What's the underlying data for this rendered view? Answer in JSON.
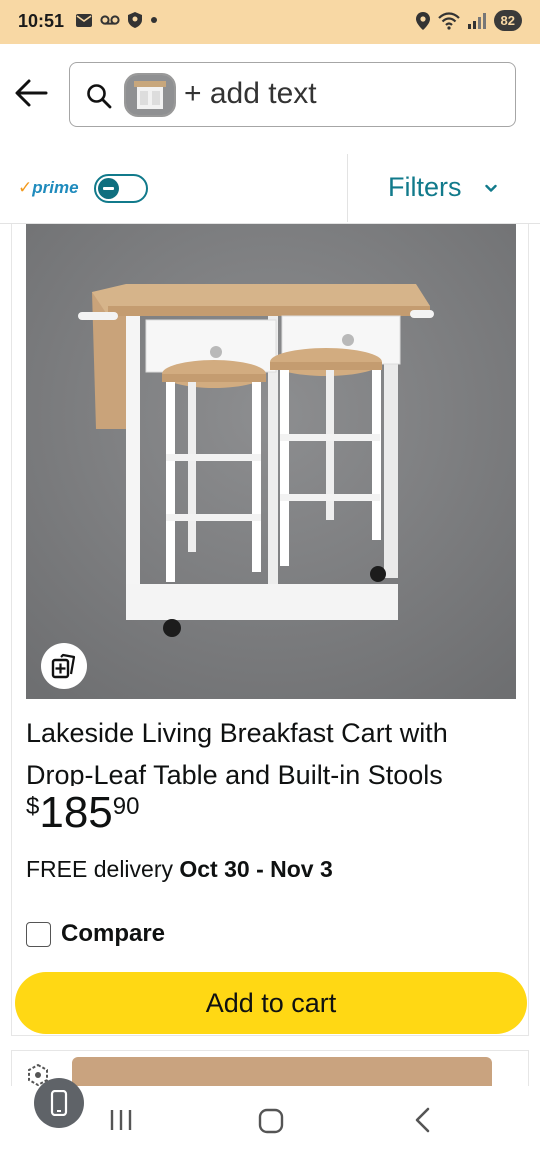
{
  "status_bar": {
    "time": "10:51",
    "battery": "82",
    "left_icons": [
      "mail-icon",
      "voicemail-icon",
      "shield-icon",
      "dot-icon"
    ],
    "right_icons": [
      "location-icon",
      "wifi-icon",
      "signal-icon"
    ]
  },
  "header": {
    "back_icon": "arrow-left-icon",
    "search_icon": "search-icon",
    "search_placeholder": "+ add text"
  },
  "filter_bar": {
    "prime_check": "✓",
    "prime_label": "prime",
    "prime_toggle_on": false,
    "filters_label": "Filters"
  },
  "product": {
    "title": "Lakeside Living Breakfast Cart with Drop-Leaf Table and Built-in Stools",
    "price_currency": "$",
    "price_whole": "185",
    "price_fraction": "90",
    "delivery_prefix": "FREE delivery ",
    "delivery_dates": "Oct 30 - Nov 3",
    "compare_label": "Compare",
    "compare_checked": false,
    "add_to_cart_label": "Add to cart"
  },
  "colors": {
    "status_bar": "#f8d8a4",
    "teal_accent": "#117a8b",
    "prime_blue": "#1f8bbd",
    "cart_button": "#ffd814"
  },
  "nav_bar": {
    "icons": [
      "recents-icon",
      "home-icon",
      "back-chevron-icon"
    ],
    "floating_button_icon": "phone-icon"
  }
}
